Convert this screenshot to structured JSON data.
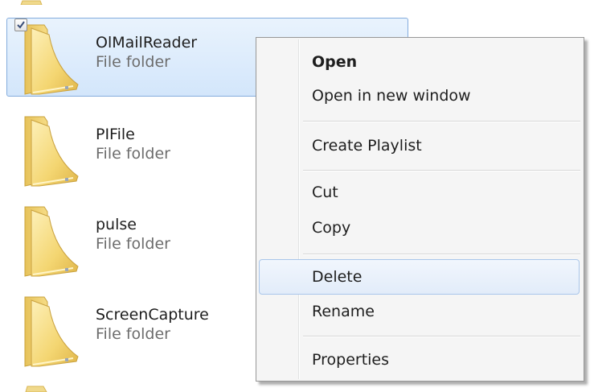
{
  "files": [
    {
      "name": "OlMailReader",
      "type": "File folder",
      "selected": true,
      "checked": true
    },
    {
      "name": "PIFile",
      "type": "File folder",
      "selected": false,
      "checked": false
    },
    {
      "name": "pulse",
      "type": "File folder",
      "selected": false,
      "checked": false
    },
    {
      "name": "ScreenCapture",
      "type": "File folder",
      "selected": false,
      "checked": false
    }
  ],
  "context_menu": {
    "items": [
      {
        "label": "Open",
        "bold": true
      },
      {
        "label": "Open in new window"
      },
      {
        "label": "Create Playlist"
      },
      {
        "label": "Cut"
      },
      {
        "label": "Copy"
      },
      {
        "label": "Delete",
        "highlighted": true
      },
      {
        "label": "Rename"
      },
      {
        "label": "Properties"
      }
    ]
  },
  "colors": {
    "selection_bg": "#d3e6fb",
    "selection_border": "#84acdd",
    "menu_bg": "#f5f5f5",
    "menu_hover_border": "#a9c6ea",
    "folder_yellow": "#f3d46c"
  }
}
